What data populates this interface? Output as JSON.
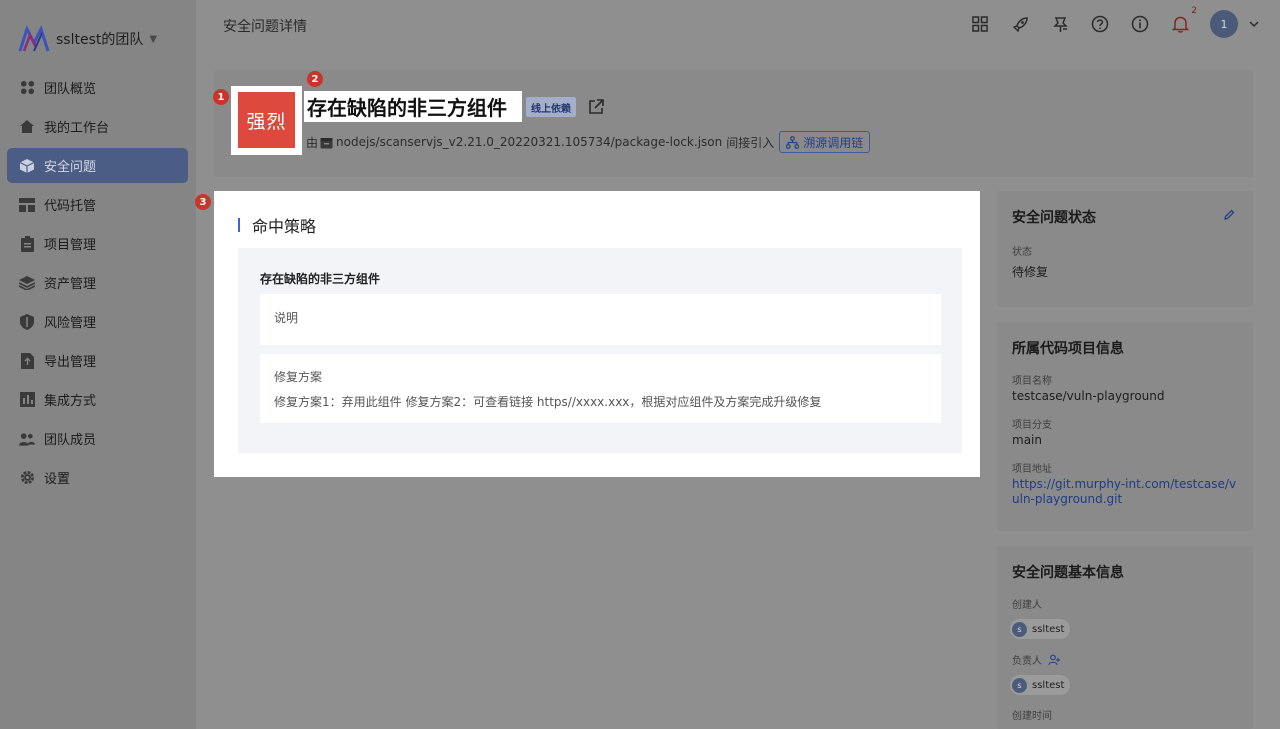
{
  "sidebar": {
    "team_name": "ssltest的团队",
    "items": [
      {
        "label": "团队概览",
        "icon": "dashboard-icon"
      },
      {
        "label": "我的工作台",
        "icon": "home-icon"
      },
      {
        "label": "安全问题",
        "icon": "cube-icon",
        "active": true
      },
      {
        "label": "代码托管",
        "icon": "layout-icon"
      },
      {
        "label": "项目管理",
        "icon": "clipboard-icon"
      },
      {
        "label": "资产管理",
        "icon": "layers-icon"
      },
      {
        "label": "风险管理",
        "icon": "shield-icon"
      },
      {
        "label": "导出管理",
        "icon": "export-icon"
      },
      {
        "label": "集成方式",
        "icon": "integration-icon"
      },
      {
        "label": "团队成员",
        "icon": "team-icon"
      },
      {
        "label": "设置",
        "icon": "gear-icon"
      }
    ]
  },
  "topbar": {
    "title": "安全问题详情",
    "notification_count": "2",
    "avatar_initial": "1"
  },
  "issue": {
    "severity": "强烈",
    "title": "存在缺陷的非三方组件",
    "tag": "线上依赖",
    "path_prefix": "由",
    "path": "nodejs/scanservjs_v2.21.0_20220321.105734/package-lock.json",
    "path_suffix": "间接引入",
    "trace_label": "溯源调用链"
  },
  "markers": [
    "1",
    "2",
    "3"
  ],
  "policy": {
    "heading": "命中策略",
    "rule_name": "存在缺陷的非三方组件",
    "desc_label": "说明",
    "fix_label": "修复方案",
    "fix_text": "修复方案1：弃用此组件 修复方案2：可查看链接 https//xxxx.xxx，根据对应组件及方案完成升级修复"
  },
  "status_card": {
    "title": "安全问题状态",
    "status_label": "状态",
    "status_value": "待修复"
  },
  "project_card": {
    "title": "所属代码项目信息",
    "name_label": "项目名称",
    "name_value": "testcase/vuln-playground",
    "branch_label": "项目分支",
    "branch_value": "main",
    "url_label": "项目地址",
    "url_value": "https://git.murphy-int.com/testcase/vuln-playground.git"
  },
  "basic_card": {
    "title": "安全问题基本信息",
    "creator_label": "创建人",
    "creator_initial": "s",
    "creator_name": "ssltest",
    "owner_label": "负责人",
    "owner_initial": "s",
    "owner_name": "ssltest",
    "created_time_label": "创建时间"
  },
  "colors": {
    "severity_strong": "#dd4a3d",
    "sidebar_active": "#4b5d85",
    "accent_blue": "#3d63d6",
    "marker_red": "#c5372b"
  }
}
